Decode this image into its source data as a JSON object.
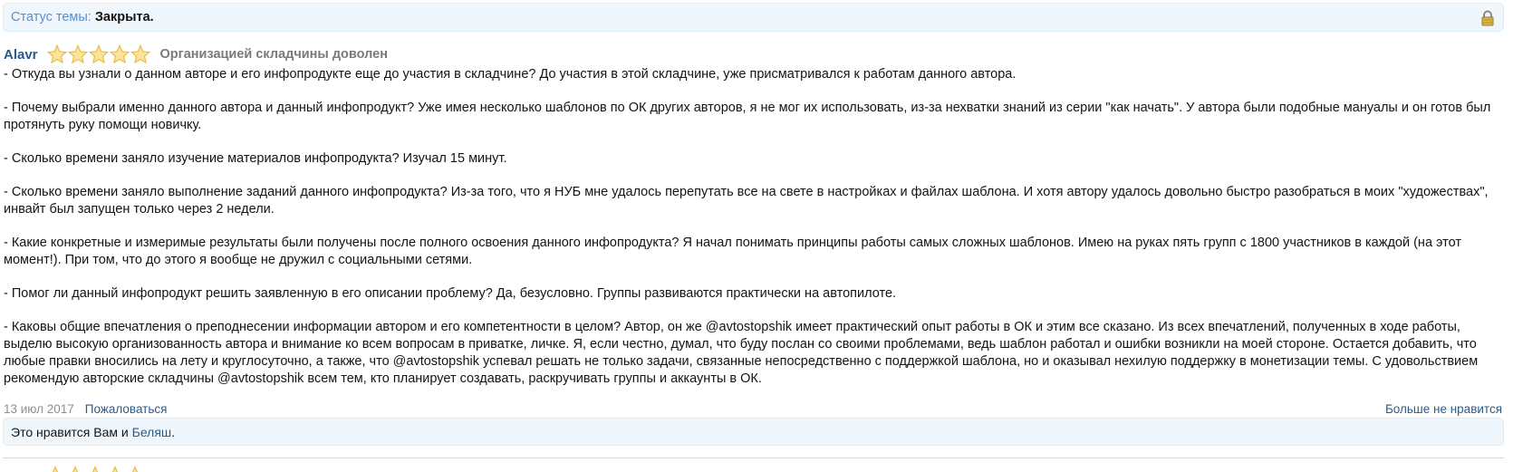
{
  "status": {
    "label": "Статус темы:",
    "value": "Закрыта."
  },
  "icons": {
    "lock": "lock-icon",
    "star": "star-icon"
  },
  "colors": {
    "link": "#2b5a8a",
    "status_label": "#5a8fc2",
    "bar_background": "#f0f7fc",
    "star": "#f5c542"
  },
  "post": {
    "author": "Alavr",
    "rating_stars": 5,
    "rating_label": "Организацией складчины доволен",
    "paragraphs": [
      "- Откуда вы узнали о данном авторе и его инфопродукте еще до участия в складчине? До участия в этой складчине, уже присматривался к работам данного автора.",
      "- Почему выбрали именно данного автора и данный инфопродукт? Уже имея несколько шаблонов по ОК других авторов, я не мог их использовать, из-за нехватки знаний из серии \"как начать\". У автора были подобные мануалы и он готов был протянуть руку помощи новичку.",
      "- Сколько времени заняло изучение материалов инфопродукта? Изучал 15 минут.",
      "- Сколько времени заняло выполнение заданий данного инфопродукта? Из-за того, что я НУБ мне удалось перепутать все на свете в настройках и файлах шаблона. И хотя автору удалось довольно быстро разобраться в моих \"художествах\", инвайт был запущен только через 2 недели.",
      "- Какие конкретные и измеримые результаты были получены после полного освоения данного инфопродукта? Я начал понимать принципы работы самых сложных шаблонов. Имею на руках пять групп с 1800 участников в каждой (на этот момент!). При том, что до этого я вообще не дружил с социальными сетями.",
      "- Помог ли данный инфопродукт решить заявленную в его описании проблему? Да, безусловно. Группы развиваются практически на автопилоте.",
      "- Каковы общие впечатления о преподнесении информации автором и его компетентности в целом? Автор, он же @avtostopshik имеет практический опыт работы в ОК и этим все сказано. Из всех впечатлений, полученных в ходе работы, выделю высокую организованность автора и внимание ко всем вопросам в приватке, личке. Я, если честно, думал, что буду послан со своими проблемами, ведь шаблон работал и ошибки возникли на моей стороне. Остается добавить, что любые правки вносились на лету и круглосуточно, а также, что @avtostopshik успевал решать не только задачи, связанные непосредственно с поддержкой шаблона, но и оказывал нехилую поддержку в монетизации темы. С удовольствием рекомендую авторские складчины @avtostopshik всем тем, кто планирует создавать, раскручивать группы и аккаунты в ОК."
    ],
    "date": "13 июл 2017",
    "report_label": "Пожаловаться",
    "unlike_label": "Больше не нравится"
  },
  "likes": {
    "prefix": "Это нравится Вам и ",
    "user": "Беляш",
    "suffix": "."
  }
}
